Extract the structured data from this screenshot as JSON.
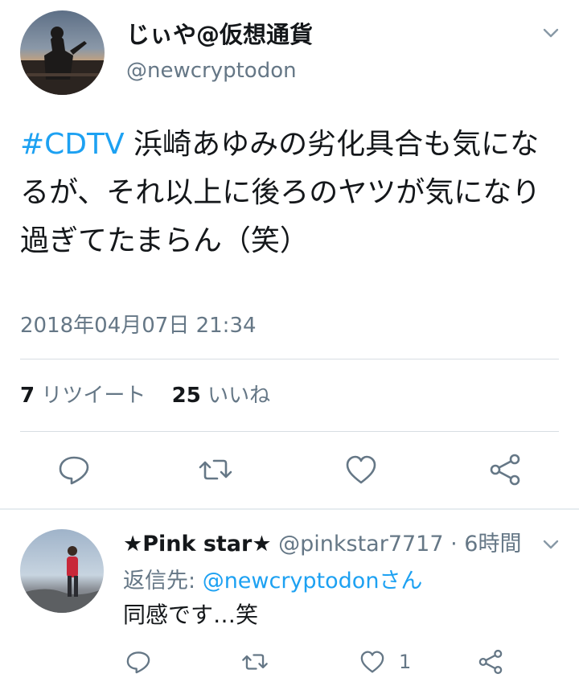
{
  "tweet": {
    "display_name": "じぃや@仮想通貨",
    "handle": "@newcryptodon",
    "hashtag": "#CDTV",
    "text": " 浜崎あゆみの劣化具合も気になるが、それ以上に後ろのヤツが気になり過ぎてたまらん（笑）",
    "timestamp": "2018年04月07日 21:34",
    "retweet_count": "7",
    "retweet_label": "リツイート",
    "like_count": "25",
    "like_label": "いいね"
  },
  "reply": {
    "display_name": "★Pink star★",
    "meta": " @pinkstar7717 · 6時間",
    "reply_to_prefix": "返信先: ",
    "reply_to_handle": "@newcryptodonさん",
    "text": "同感です…笑",
    "like_count": "1"
  },
  "icons": {
    "menu": "chevron-down-icon",
    "reply": "reply-icon",
    "retweet": "retweet-icon",
    "like": "heart-icon",
    "share": "share-icon"
  },
  "colors": {
    "accent": "#1da1f2",
    "secondary_text": "#657786",
    "primary_text": "#14171a"
  }
}
